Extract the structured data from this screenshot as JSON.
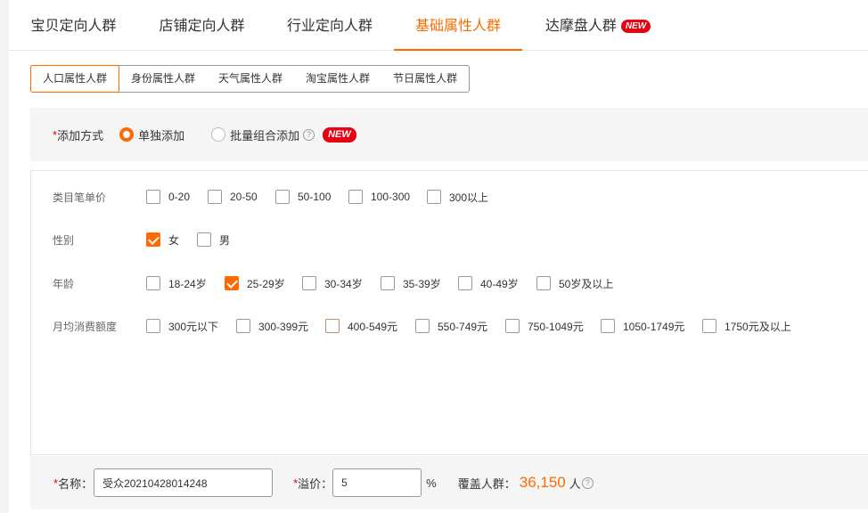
{
  "main_tabs": [
    {
      "label": "宝贝定向人群",
      "active": false
    },
    {
      "label": "店铺定向人群",
      "active": false
    },
    {
      "label": "行业定向人群",
      "active": false
    },
    {
      "label": "基础属性人群",
      "active": true
    },
    {
      "label": "达摩盘人群",
      "active": false,
      "badge": "NEW"
    }
  ],
  "sub_tabs": [
    {
      "label": "人口属性人群",
      "active": true
    },
    {
      "label": "身份属性人群",
      "active": false
    },
    {
      "label": "天气属性人群",
      "active": false
    },
    {
      "label": "淘宝属性人群",
      "active": false
    },
    {
      "label": "节日属性人群",
      "active": false
    }
  ],
  "add_mode": {
    "required_mark": "*",
    "label": "添加方式",
    "options": [
      {
        "label": "单独添加",
        "checked": true
      },
      {
        "label": "批量组合添加",
        "checked": false
      }
    ],
    "help": "?",
    "badge": "NEW"
  },
  "attributes": {
    "price": {
      "label": "类目笔单价",
      "options": [
        {
          "label": "0-20",
          "checked": false
        },
        {
          "label": "20-50",
          "checked": false
        },
        {
          "label": "50-100",
          "checked": false
        },
        {
          "label": "100-300",
          "checked": false
        },
        {
          "label": "300以上",
          "checked": false
        }
      ]
    },
    "gender": {
      "label": "性别",
      "options": [
        {
          "label": "女",
          "checked": true
        },
        {
          "label": "男",
          "checked": false
        }
      ]
    },
    "age": {
      "label": "年龄",
      "options": [
        {
          "label": "18-24岁",
          "checked": false
        },
        {
          "label": "25-29岁",
          "checked": true
        },
        {
          "label": "30-34岁",
          "checked": false
        },
        {
          "label": "35-39岁",
          "checked": false
        },
        {
          "label": "40-49岁",
          "checked": false
        },
        {
          "label": "50岁及以上",
          "checked": false
        }
      ]
    },
    "spend": {
      "label": "月均消费额度",
      "options": [
        {
          "label": "300元以下",
          "checked": false
        },
        {
          "label": "300-399元",
          "checked": false
        },
        {
          "label": "400-549元",
          "checked": false
        },
        {
          "label": "550-749元",
          "checked": false
        },
        {
          "label": "750-1049元",
          "checked": false
        },
        {
          "label": "1050-1749元",
          "checked": false
        },
        {
          "label": "1750元及以上",
          "checked": false
        }
      ]
    }
  },
  "footer": {
    "name_required": "*",
    "name_label": "名称：",
    "name_value": "受众20210428014248",
    "premium_required": "*",
    "premium_label": "溢价：",
    "premium_value": "5",
    "premium_unit": "%",
    "coverage_label": "覆盖人群：",
    "coverage_value": "36,150",
    "coverage_unit": "人",
    "help": "?"
  },
  "colors": {
    "accent": "#ff6a00",
    "badge": "#e60012"
  }
}
